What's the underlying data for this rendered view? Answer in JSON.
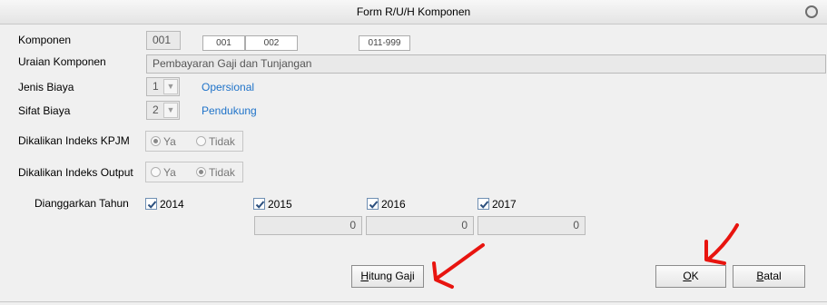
{
  "window": {
    "title": "Form R/U/H Komponen"
  },
  "komponen": {
    "label": "Komponen",
    "code": "001",
    "code_a": "001",
    "code_b": "002",
    "range": "011-999"
  },
  "uraian": {
    "label": "Uraian Komponen",
    "value": "Pembayaran Gaji dan Tunjangan"
  },
  "jenis_biaya": {
    "label": "Jenis Biaya",
    "value": "1",
    "text": "Opersional"
  },
  "sifat_biaya": {
    "label": "Sifat Biaya",
    "value": "2",
    "text": "Pendukung"
  },
  "indeks_kpjm": {
    "label": "Dikalikan Indeks KPJM",
    "options": [
      "Ya",
      "Tidak"
    ],
    "selected": "Ya"
  },
  "indeks_output": {
    "label": "Dikalikan Indeks Output",
    "options": [
      "Ya",
      "Tidak"
    ],
    "selected": "Tidak"
  },
  "dianggarkan": {
    "label": "Dianggarkan Tahun",
    "years": [
      {
        "year": "2014",
        "checked": true
      },
      {
        "year": "2015",
        "checked": true,
        "amount": "0"
      },
      {
        "year": "2016",
        "checked": true,
        "amount": "0"
      },
      {
        "year": "2017",
        "checked": true,
        "amount": "0"
      }
    ]
  },
  "buttons": {
    "hitung_gaji": {
      "label_underlined": "H",
      "label_rest": "itung Gaji"
    },
    "ok": {
      "label_underlined": "O",
      "label_rest": "K"
    },
    "batal": {
      "label_underlined": "B",
      "label_rest": "atal"
    }
  },
  "icons": {
    "close": "circle-close-icon",
    "dropdown": "chevron-down-icon",
    "check": "checkmark-icon",
    "annotation": "red-arrow-annotation"
  },
  "colors": {
    "link": "#1f73c9",
    "annotation": "#e8140f",
    "window_bg": "#f0f0f0"
  }
}
